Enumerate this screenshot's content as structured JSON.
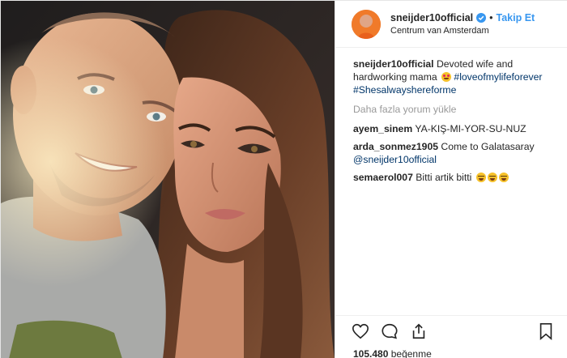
{
  "post": {
    "username": "sneijder10official",
    "follow_label": "Takip Et",
    "location": "Centrum van Amsterdam",
    "caption": {
      "user": "sneijder10official",
      "text": "Devoted wife and hardworking mama",
      "hashtag_1": "#loveofmylifeforever",
      "hashtag_2": "#Shesalwayshereforme"
    },
    "load_more_label": "Daha fazla yorum yükle",
    "comments": [
      {
        "user": "ayem_sinem",
        "text": "YA-KIŞ-MI-YOR-SU-NUZ"
      },
      {
        "user": "arda_sonmez1905",
        "text": "Come to Galatasaray",
        "mention": "@sneijder10official"
      },
      {
        "user": "semaerol007",
        "text": "Bitti artik bitti"
      }
    ],
    "likes_count": "105.480",
    "likes_label": "beğenme"
  },
  "colors": {
    "link": "#3897f0",
    "hashtag": "#003569",
    "muted": "#999999",
    "text": "#262626"
  },
  "icons": {
    "like": "heart-icon",
    "comment": "comment-icon",
    "share": "share-icon",
    "save": "bookmark-icon",
    "verified": "verified-badge-icon"
  }
}
